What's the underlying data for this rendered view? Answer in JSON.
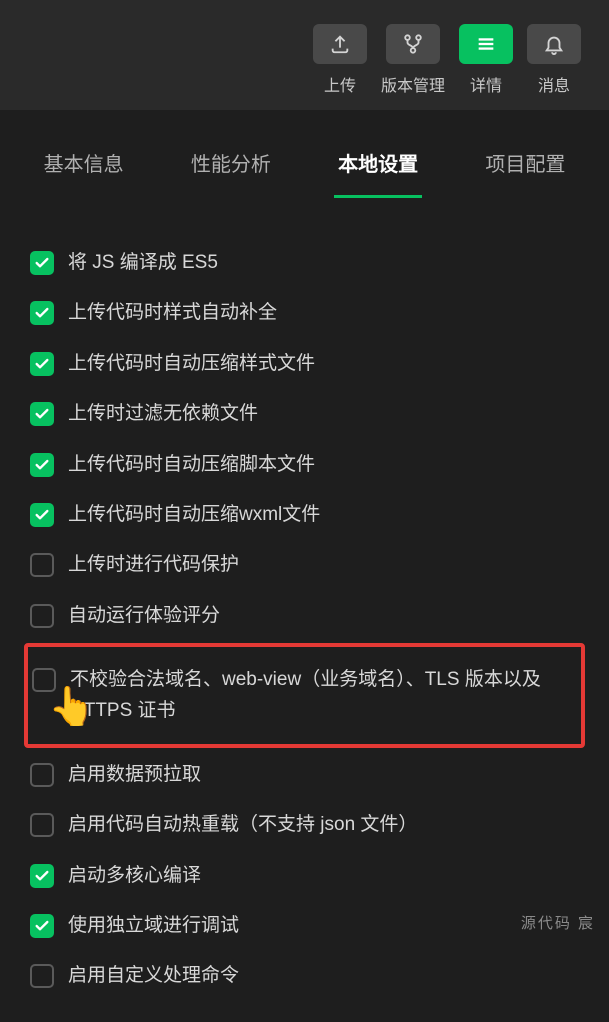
{
  "toolbar": {
    "upload": {
      "label": "上传"
    },
    "version": {
      "label": "版本管理"
    },
    "details": {
      "label": "详情"
    },
    "messages": {
      "label": "消息"
    }
  },
  "tabs": {
    "basic": "基本信息",
    "perf": "性能分析",
    "local": "本地设置",
    "project": "项目配置"
  },
  "settings": [
    {
      "checked": true,
      "label": "将 JS 编译成 ES5"
    },
    {
      "checked": true,
      "label": "上传代码时样式自动补全"
    },
    {
      "checked": true,
      "label": "上传代码时自动压缩样式文件"
    },
    {
      "checked": true,
      "label": "上传时过滤无依赖文件"
    },
    {
      "checked": true,
      "label": "上传代码时自动压缩脚本文件"
    },
    {
      "checked": true,
      "label": "上传代码时自动压缩wxml文件"
    },
    {
      "checked": false,
      "label": "上传时进行代码保护"
    },
    {
      "checked": false,
      "label": "自动运行体验评分"
    },
    {
      "checked": false,
      "label": "不校验合法域名、web-view（业务域名）、TLS 版本以及 HTTPS 证书",
      "highlight": true
    },
    {
      "checked": false,
      "label": "启用数据预拉取"
    },
    {
      "checked": false,
      "label": "启用代码自动热重载（不支持 json 文件）"
    },
    {
      "checked": true,
      "label": "启动多核心编译"
    },
    {
      "checked": true,
      "label": "使用独立域进行调试"
    },
    {
      "checked": false,
      "label": "启用自定义处理命令"
    }
  ],
  "footer": "源代码   宸",
  "colors": {
    "accent": "#07c160",
    "highlight": "#e53935",
    "bg": "#1e1e1e"
  }
}
